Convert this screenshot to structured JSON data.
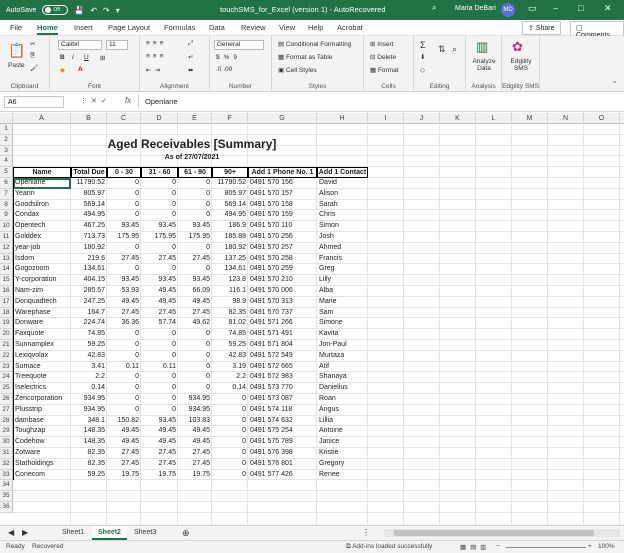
{
  "titlebar": {
    "autosave": "AutoSave",
    "autosave_state": "Off",
    "title": "touchSMS_for_Excel (version 1)  -  AutoRecovered",
    "user": "Maria DeBari",
    "initials": "MD"
  },
  "tabs": [
    "File",
    "Home",
    "Insert",
    "Page Layout",
    "Formulas",
    "Data",
    "Review",
    "View",
    "Help",
    "Acrobat"
  ],
  "share": "Share",
  "comments": "Comments",
  "ribbon": {
    "clipboard": {
      "paste": "Paste",
      "label": "Clipboard"
    },
    "font": {
      "name": "Calibri",
      "size": "11",
      "label": "Font"
    },
    "alignment": {
      "label": "Alignment"
    },
    "number": {
      "format": "General",
      "label": "Number"
    },
    "styles": {
      "conditional": "Conditional Formatting",
      "format_table": "Format as Table",
      "cell_styles": "Cell Styles",
      "label": "Styles"
    },
    "cells": {
      "insert": "Insert",
      "delete": "Delete",
      "format": "Format",
      "label": "Cells"
    },
    "editing": {
      "label": "Editing"
    },
    "analysis": {
      "analyze": "Analyze Data",
      "label": "Analysis"
    },
    "edgility": {
      "sms": "Edgility SMS",
      "label": "Edgility SMS"
    }
  },
  "formula_bar": {
    "name_box": "A6",
    "value": "Openlane"
  },
  "columns": [
    "A",
    "B",
    "C",
    "D",
    "E",
    "F",
    "G",
    "H",
    "I",
    "J",
    "K",
    "L",
    "M",
    "N",
    "O"
  ],
  "rows": [
    "1",
    "2",
    "3",
    "4",
    "5",
    "6",
    "7",
    "8",
    "9",
    "10",
    "11",
    "12",
    "13",
    "14",
    "15",
    "16",
    "17",
    "18",
    "19",
    "20",
    "21",
    "22",
    "23",
    "24",
    "25",
    "26",
    "27",
    "28",
    "29",
    "30",
    "31",
    "32",
    "33",
    "34",
    "35",
    "36"
  ],
  "sheet": {
    "title": "Aged Receivables [Summary]",
    "subtitle": "As of 27/07/2021",
    "headers": [
      "Name",
      "Total Due",
      "0 - 30",
      "31 - 60",
      "61 - 90",
      "90+",
      "Add 1 Phone No. 1",
      "Add 1 Contact"
    ],
    "data": [
      [
        "Openlane",
        "11790.52",
        "0",
        "0",
        "0",
        "11790.52",
        "0491 570 156",
        "David"
      ],
      [
        "Yearin",
        "805.97",
        "0",
        "0",
        "0",
        "805.97",
        "0491 570 157",
        "Alison"
      ],
      [
        "Goodsilron",
        "569.14",
        "0",
        "0",
        "0",
        "569.14",
        "0491 570 158",
        "Sarah"
      ],
      [
        "Condax",
        "494.95",
        "0",
        "0",
        "0",
        "494.95",
        "0491 570 159",
        "Chris"
      ],
      [
        "Opentech",
        "467.25",
        "93.45",
        "93.45",
        "93.45",
        "186.9",
        "0491 570 110",
        "Simon"
      ],
      [
        "Golddex",
        "713.73",
        "175.95",
        "175.95",
        "175.95",
        "185.88",
        "0491 570 256",
        "Josh"
      ],
      [
        "year-job",
        "180.92",
        "0",
        "0",
        "0",
        "180.92",
        "0491 570 257",
        "Ahmed"
      ],
      [
        "Isdom",
        "219.6",
        "27.45",
        "27.45",
        "27.45",
        "137.25",
        "0491 570 258",
        "Francis"
      ],
      [
        "Gogozoom",
        "134.61",
        "0",
        "0",
        "0",
        "134.61",
        "0491 570 259",
        "Greg"
      ],
      [
        "Y-corporation",
        "404.15",
        "93.45",
        "93.45",
        "93.45",
        "123.8",
        "0491 570 210",
        "Lilly"
      ],
      [
        "Nam-zim",
        "285.57",
        "53.93",
        "49.45",
        "66.09",
        "116.1",
        "0491 570 006",
        "Alba"
      ],
      [
        "Donquadtech",
        "247.25",
        "49.45",
        "49.45",
        "49.45",
        "98.9",
        "0491 570 313",
        "Marie"
      ],
      [
        "Warephase",
        "164.7",
        "27.45",
        "27.45",
        "27.45",
        "82.35",
        "0491 570 737",
        "Sam"
      ],
      [
        "Donware",
        "224.74",
        "36.36",
        "57.74",
        "49.62",
        "81.02",
        "0491 571 266",
        "Simone"
      ],
      [
        "Faxquote",
        "74.85",
        "0",
        "0",
        "0",
        "74.85",
        "0491 571 491",
        "Kavita"
      ],
      [
        "Sunnamplex",
        "59.25",
        "0",
        "0",
        "0",
        "59.25",
        "0491 571 804",
        "Jon-Paul"
      ],
      [
        "Lexiqvolax",
        "42.83",
        "0",
        "0",
        "0",
        "42.83",
        "0491 572 549",
        "Murtaza"
      ],
      [
        "Sumace",
        "3.41",
        "0.11",
        "0.11",
        "0",
        "3.19",
        "0491 572 665",
        "Atif"
      ],
      [
        "Treequote",
        "2.2",
        "0",
        "0",
        "0",
        "2.2",
        "0491 572 983",
        "Shanaya"
      ],
      [
        "Iselectrics",
        "0.14",
        "0",
        "0",
        "0",
        "0.14",
        "0491 573 770",
        "Danielius"
      ],
      [
        "Zencorporation",
        "934.95",
        "0",
        "0",
        "934.95",
        "0",
        "0491 573 087",
        "Roan"
      ],
      [
        "Plusstrip",
        "934.95",
        "0",
        "0",
        "934.95",
        "0",
        "0491 574 118",
        "Angus"
      ],
      [
        "dambase",
        "348.1",
        "150.82",
        "93.45",
        "103.83",
        "0",
        "0491 574 632",
        "Lillia"
      ],
      [
        "Toughzap",
        "148.35",
        "49.45",
        "49.45",
        "49.45",
        "0",
        "0491 575 254",
        "Antoine"
      ],
      [
        "Codehow",
        "148.35",
        "49.45",
        "49.45",
        "49.45",
        "0",
        "0491 575 789",
        "Janice"
      ],
      [
        "Zotware",
        "82.35",
        "27.45",
        "27.45",
        "27.45",
        "0",
        "0491 576 398",
        "Kristie"
      ],
      [
        "Statholdings",
        "82.35",
        "27.45",
        "27.45",
        "27.45",
        "0",
        "0491 576 801",
        "Gregory"
      ],
      [
        "Conecom",
        "59.25",
        "19.75",
        "19.75",
        "19.75",
        "0",
        "0491 577 426",
        "Renee"
      ]
    ]
  },
  "sheet_tabs": [
    "Sheet1",
    "Sheet2",
    "Sheet3"
  ],
  "active_sheet": "Sheet2",
  "status": {
    "ready": "Ready",
    "recovered": "Recovered",
    "addins": "Add-ins loaded successfully",
    "zoom": "100%"
  },
  "colors": {
    "excel_green": "#217346"
  }
}
